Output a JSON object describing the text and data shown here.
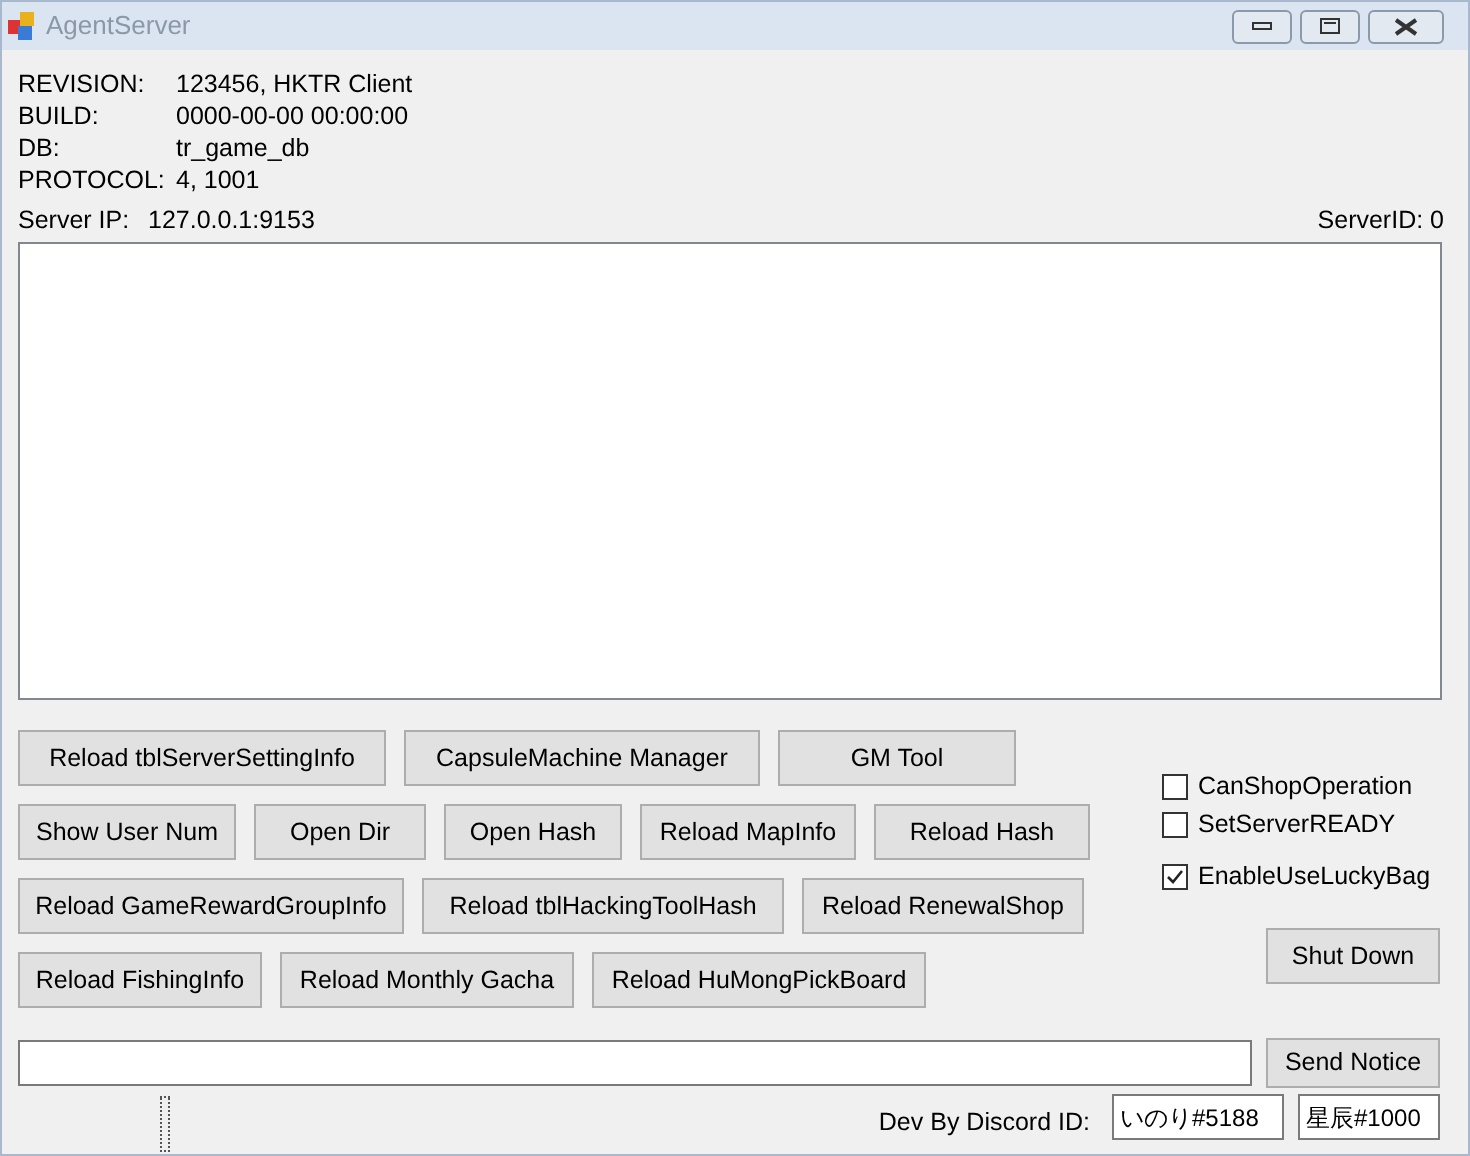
{
  "window": {
    "title": "AgentServer"
  },
  "info": [
    {
      "label": "REVISION:",
      "value": "123456, HKTR Client"
    },
    {
      "label": "BUILD:",
      "value": "0000-00-00 00:00:00"
    },
    {
      "label": "DB:",
      "value": "tr_game_db"
    },
    {
      "label": "PROTOCOL:",
      "value": "4, 1001"
    }
  ],
  "server_ip": {
    "label": "Server IP:",
    "value": "127.0.0.1:9153"
  },
  "server_id": "ServerID: 0",
  "button_rows": [
    [
      "Reload tblServerSettingInfo",
      "CapsuleMachine Manager",
      "GM Tool"
    ],
    [
      "Show User Num",
      "Open Dir",
      "Open Hash",
      "Reload MapInfo",
      "Reload Hash"
    ],
    [
      "Reload GameRewardGroupInfo",
      "Reload tblHackingToolHash",
      "Reload RenewalShop"
    ],
    [
      "Reload FishingInfo",
      "Reload Monthly Gacha",
      "Reload HuMongPickBoard"
    ]
  ],
  "checkboxes": [
    {
      "label": "CanShopOperation",
      "checked": false
    },
    {
      "label": "SetServerREADY",
      "checked": false
    },
    {
      "label": "EnableUseLuckyBag",
      "checked": true
    }
  ],
  "shutdown_button": "Shut Down",
  "notice_button": "Send Notice",
  "dev_label": "Dev By Discord ID:",
  "discord_ids": [
    "いのり#5188",
    "星辰#1000"
  ]
}
